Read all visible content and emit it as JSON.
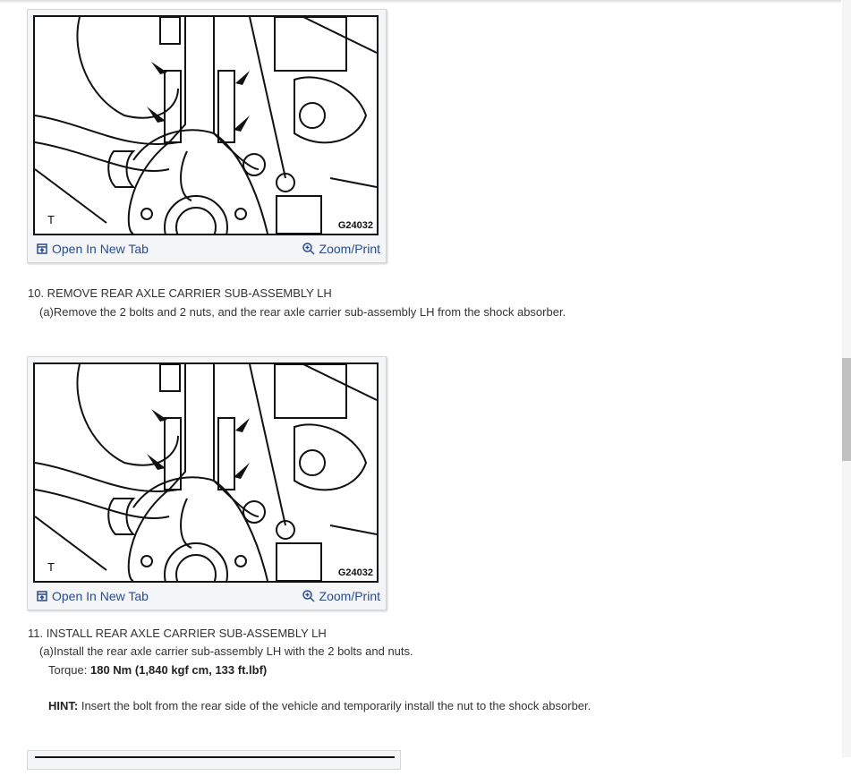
{
  "figures": [
    {
      "code": "G24032",
      "corner_label": "T",
      "open_label": "Open In New Tab",
      "zoom_label": "Zoom/Print"
    },
    {
      "code": "G24032",
      "corner_label": "T",
      "open_label": "Open In New Tab",
      "zoom_label": "Zoom/Print"
    }
  ],
  "steps": [
    {
      "title": "10. REMOVE REAR AXLE CARRIER SUB-ASSEMBLY LH",
      "sub": "(a)Remove the 2 bolts and 2 nuts, and the rear axle carrier sub-assembly LH from the shock absorber."
    },
    {
      "title": "11. INSTALL REAR AXLE CARRIER SUB-ASSEMBLY LH",
      "sub": "(a)Install the rear axle carrier sub-assembly LH with the 2 bolts and nuts.",
      "torque_label": "Torque: ",
      "torque_value": "180 Nm (1,840 kgf cm, 133 ft.lbf)",
      "hint_label": "HINT:",
      "hint_text": " Insert the bolt from the rear side of the vehicle and temporarily install the nut to the shock absorber."
    }
  ]
}
